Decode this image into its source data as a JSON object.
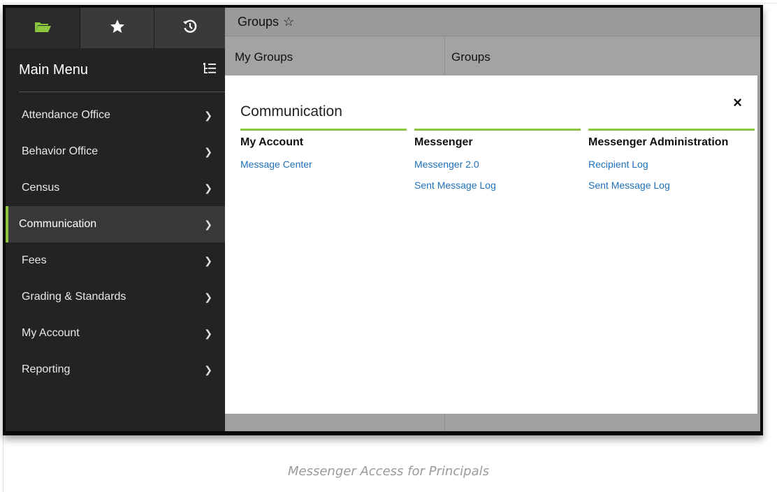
{
  "tabs": [
    {
      "icon": "folder-icon"
    },
    {
      "icon": "star-icon"
    },
    {
      "icon": "history-icon"
    }
  ],
  "menu": {
    "title": "Main Menu",
    "items": [
      {
        "label": "Attendance Office"
      },
      {
        "label": "Behavior Office"
      },
      {
        "label": "Census"
      },
      {
        "label": "Communication",
        "active": true
      },
      {
        "label": "Fees"
      },
      {
        "label": "Grading & Standards"
      },
      {
        "label": "My Account"
      },
      {
        "label": "Reporting"
      }
    ]
  },
  "page": {
    "title": "Groups",
    "col1": "My Groups",
    "col2": "Groups"
  },
  "panel": {
    "title": "Communication",
    "close": "×",
    "sections": [
      {
        "heading": "My Account",
        "links": [
          "Message Center"
        ]
      },
      {
        "heading": "Messenger",
        "links": [
          "Messenger 2.0",
          "Sent Message Log"
        ]
      },
      {
        "heading": "Messenger Administration",
        "links": [
          "Recipient Log",
          "Sent Message Log"
        ]
      }
    ]
  },
  "caption": "Messenger Access for Principals",
  "colors": {
    "accent": "#8cc63f",
    "link": "#1f6fb8",
    "sidebar": "#232323"
  }
}
